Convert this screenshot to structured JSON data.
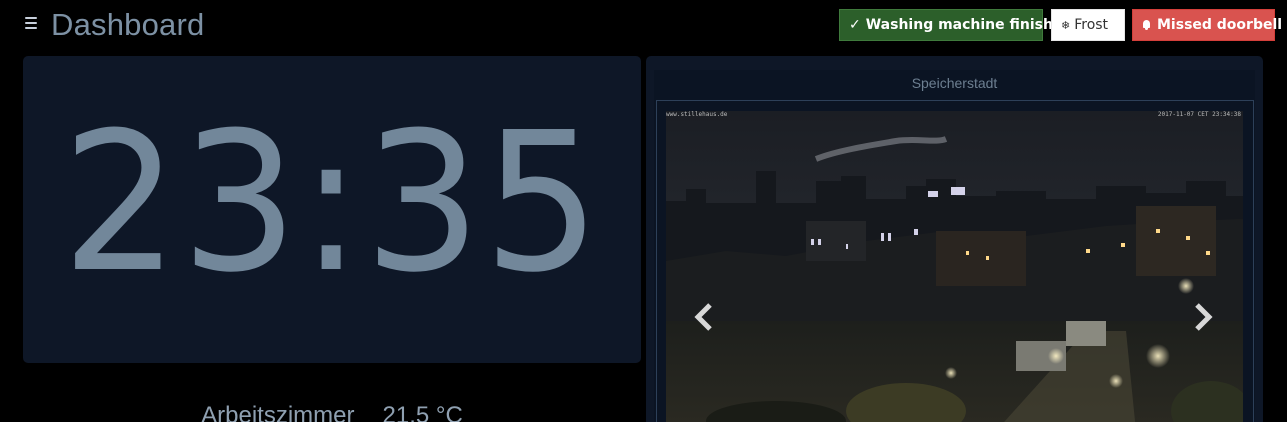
{
  "header": {
    "title": "Dashboard",
    "menu_icon": "hamburger-menu-icon"
  },
  "notifications": [
    {
      "icon": "check-icon",
      "icon_glyph": "✓",
      "label": "Washing machine finished",
      "color": "#2c5f2a"
    },
    {
      "icon": "snowflake-icon",
      "icon_glyph": "❄",
      "label": "Frost",
      "color": "#ffffff"
    },
    {
      "icon": "bell-icon",
      "label": "Missed doorbell",
      "color": "#d9534f"
    }
  ],
  "clock": {
    "time": "23:35"
  },
  "temperature": {
    "room": "Arbeitszimmer",
    "value": "21.5 °C"
  },
  "camera": {
    "title": "Speicherstadt",
    "overlay_left": "www.stillehaus.de",
    "overlay_right": "2017-11-07 CET 23:34:38",
    "prev_icon": "chevron-left-icon",
    "next_icon": "chevron-right-icon"
  },
  "colors": {
    "background": "#000000",
    "panel": "#0e1727",
    "text_muted": "#7d91a4"
  }
}
